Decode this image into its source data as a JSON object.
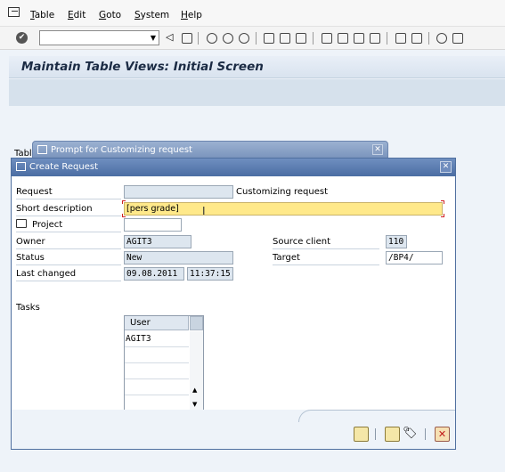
{
  "menubar": {
    "items": [
      "Table",
      "Edit",
      "Goto",
      "System",
      "Help"
    ],
    "underline": [
      "T",
      "E",
      "G",
      "S",
      "H"
    ]
  },
  "toolbar": {
    "command_field_value": ""
  },
  "screen": {
    "title": "Maintain Table Views: Initial Screen",
    "partial_label": "Tabl"
  },
  "prompt_dialog": {
    "title": "Prompt for Customizing request"
  },
  "create_request_dialog": {
    "title": "Create Request",
    "request_label": "Request",
    "request_value": "",
    "request_type": "Customizing request",
    "short_description_label": "Short description",
    "short_description_value": "[pers grade]",
    "project_label": "Project",
    "project_value": "",
    "owner_label": "Owner",
    "owner_value": "AGIT3",
    "status_label": "Status",
    "status_value": "New",
    "last_changed_label": "Last changed",
    "last_changed_date": "09.08.2011",
    "last_changed_time": "11:37:15",
    "source_client_label": "Source client",
    "source_client_value": "110",
    "target_label": "Target",
    "target_value": "/BP4/",
    "tasks_label": "Tasks",
    "tasks_table": {
      "header": "User",
      "rows": [
        "AGIT3",
        "",
        "",
        "",
        ""
      ]
    }
  },
  "icons": [
    "sap-system-icon",
    "enter-icon",
    "save-icon",
    "back-icon",
    "exit-icon",
    "cancel-icon",
    "print-icon",
    "find-icon",
    "find-next-icon",
    "first-page-icon",
    "previous-page-icon",
    "next-page-icon",
    "last-page-icon",
    "create-session-icon",
    "shortcut-icon",
    "help-icon",
    "layout-icon",
    "project-icon",
    "save-request-icon",
    "save-transport-icon",
    "cancel-x-icon"
  ],
  "colors": {
    "title_text": "#1b2b44",
    "dialog_header": "#4b6da3",
    "required_field": "#ffe98a",
    "cancel": "#c01818"
  }
}
